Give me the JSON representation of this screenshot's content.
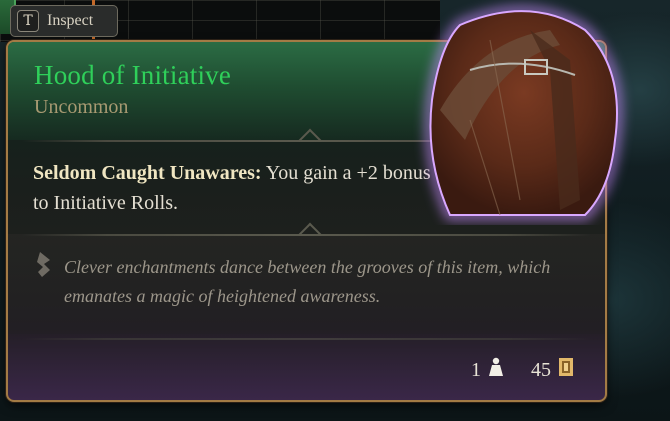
{
  "inspect": {
    "key": "T",
    "label": "Inspect"
  },
  "item": {
    "name": "Hood of Initiative",
    "rarity": "Uncommon",
    "ability_name": "Seldom Caught Unawares:",
    "ability_text": " You gain a +2 bonus to Initiative Rolls.",
    "flavor": "Clever enchantments dance between the grooves of this item, which emanates a magic of heightened awareness.",
    "weight": "1",
    "value": "45"
  },
  "colors": {
    "name": "#2fd05a",
    "rarity": "#a89a72",
    "border": "#a37b45",
    "glow": "#c98cff"
  },
  "icons": {
    "flavor": "feather-icon",
    "weight": "weight-icon",
    "value": "gold-coin-icon"
  }
}
